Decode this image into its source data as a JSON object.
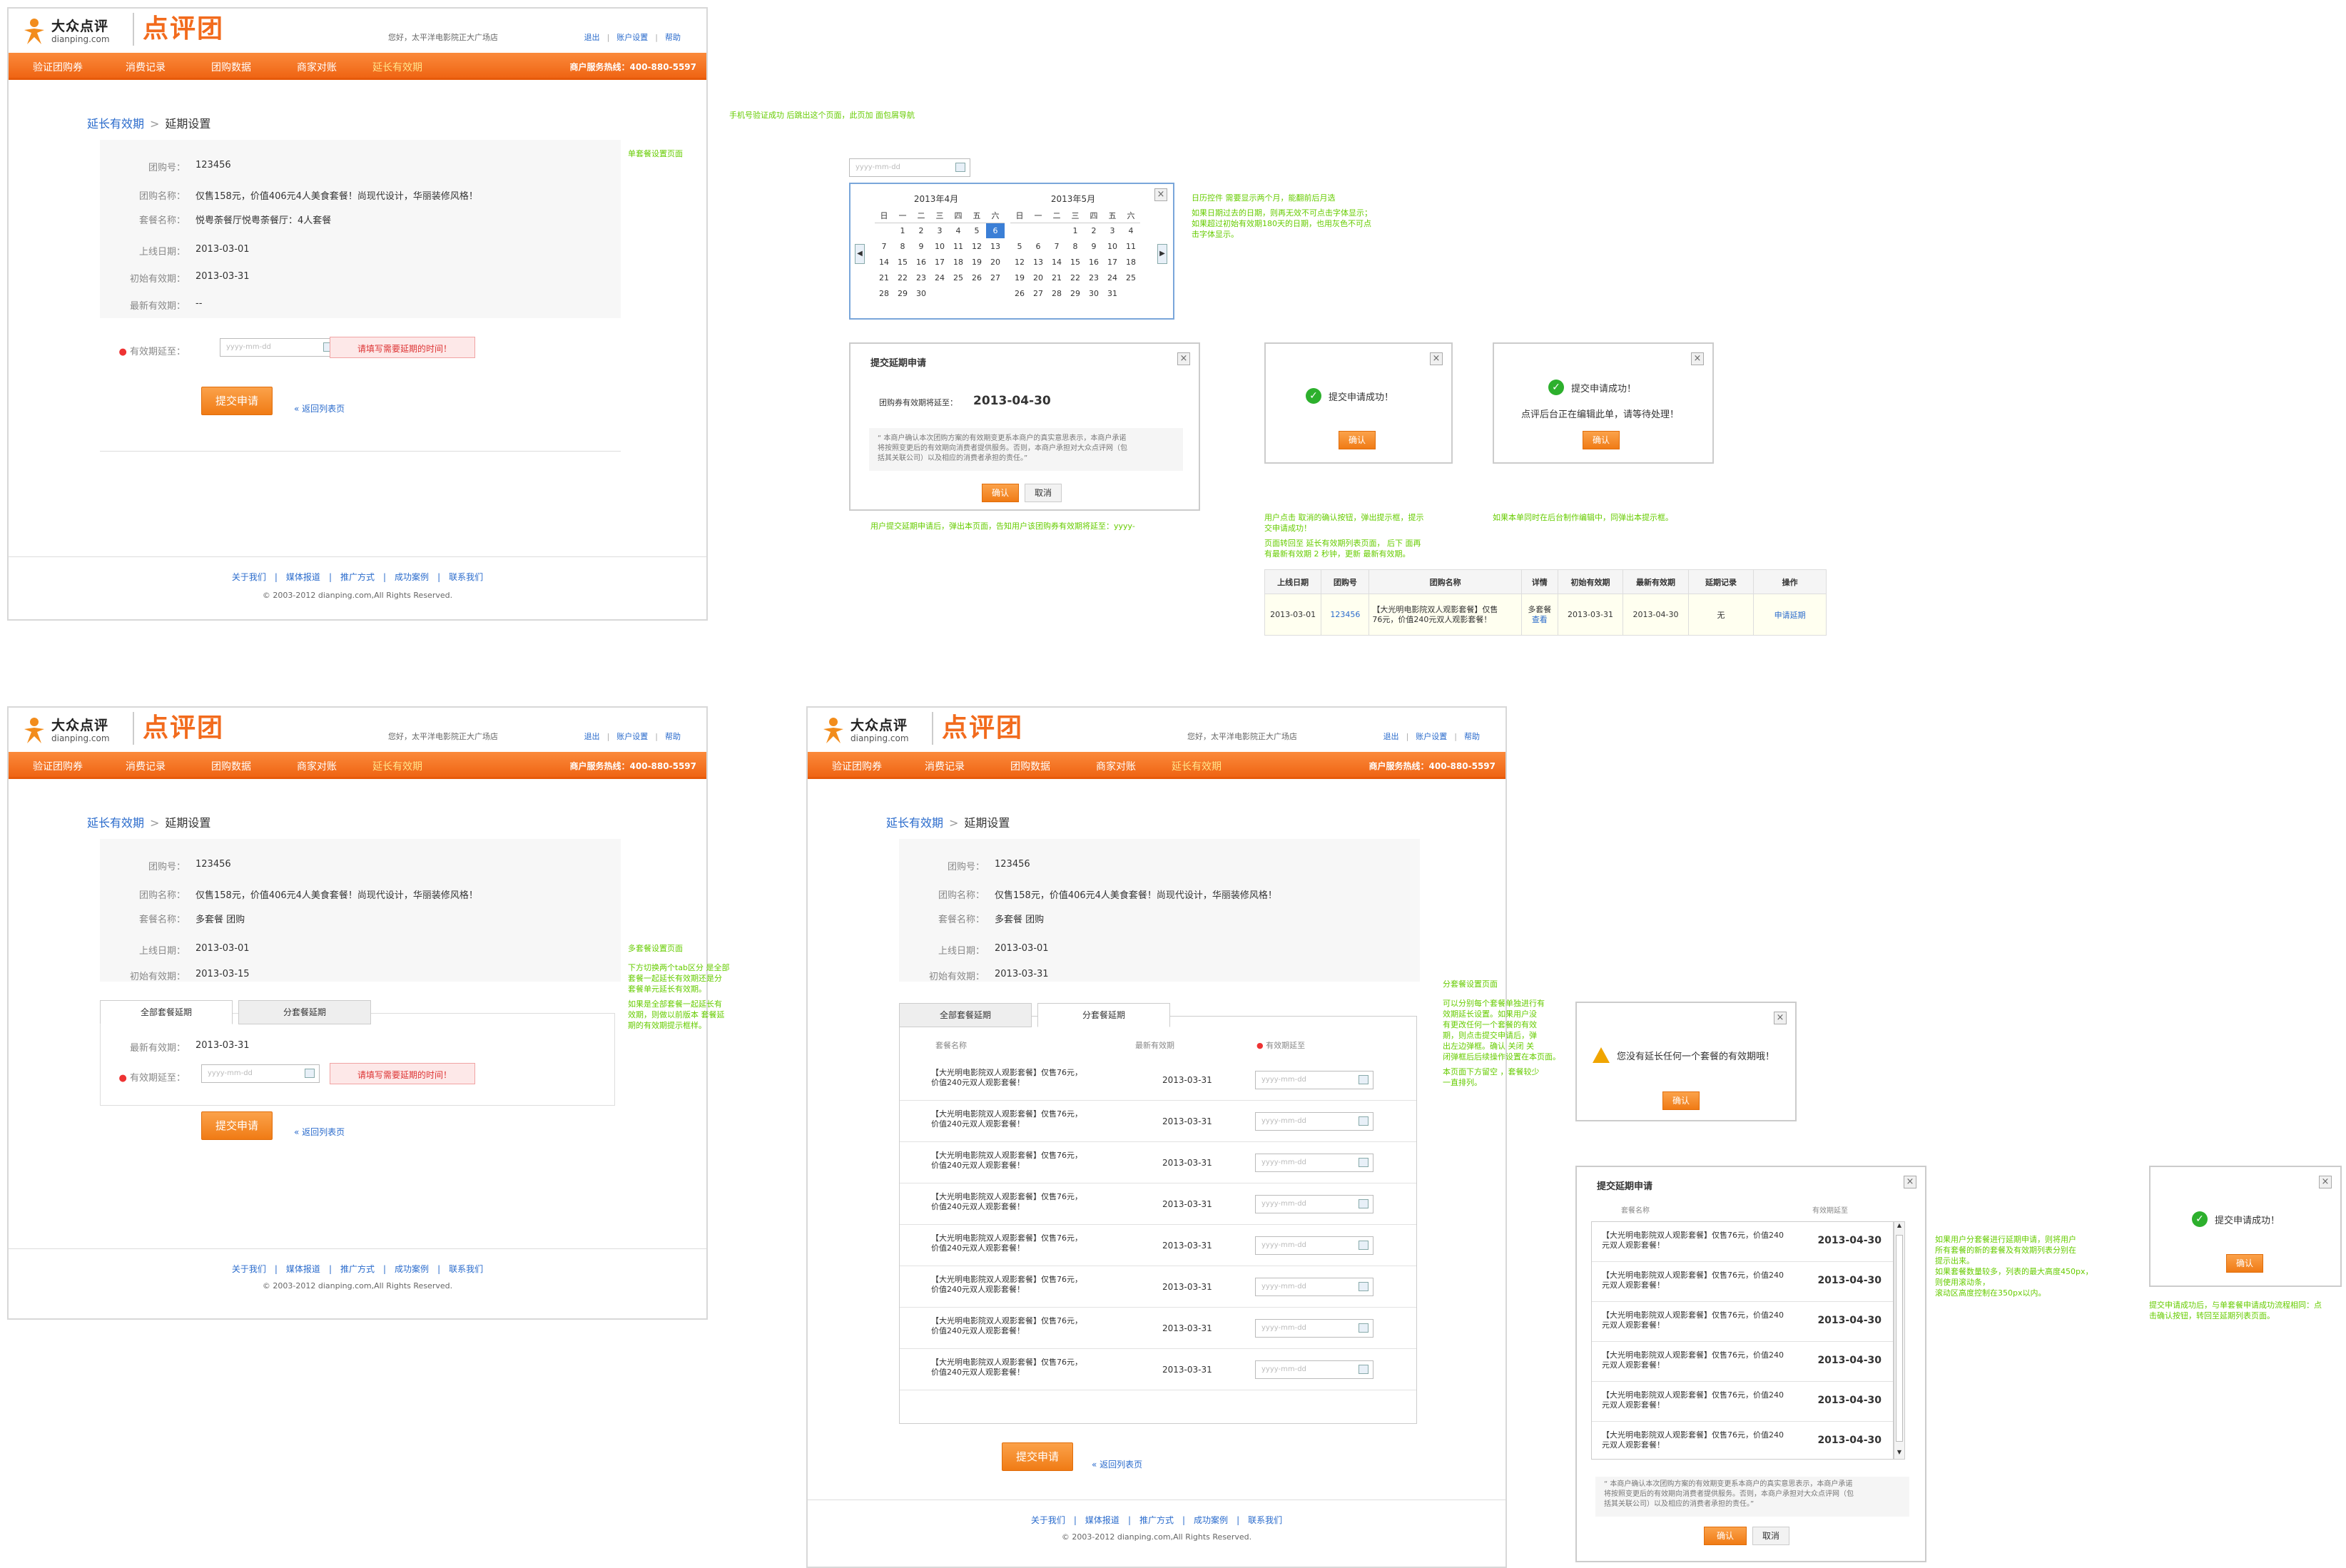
{
  "header": {
    "logo_cn": "大众点评",
    "logo_en": "dianping.com",
    "brand": "点评团",
    "greeting": "您好，太平洋电影院正大广场店",
    "links": [
      "退出",
      "账户设置",
      "帮助"
    ],
    "nav": [
      "验证团购券",
      "消费记录",
      "团购数据",
      "商家对账",
      "延长有效期"
    ],
    "hotline": "商户服务热线：400-880-5597"
  },
  "crumb": {
    "parent": "延长有效期",
    "current": "延期设置"
  },
  "labels": {
    "deal_id": "团购号：",
    "deal_name": "团购名称：",
    "package": "套餐名称：",
    "online": "上线日期：",
    "init_valid": "初始有效期：",
    "latest_valid": "最新有效期：",
    "extend_to": "有效期延至："
  },
  "deal": {
    "id": "123456",
    "name": "仅售158元，价值406元4人美食套餐！尚现代设计，华丽装修风格！",
    "package1": "悦粤荼餐厅悦粤荼餐厅：4人套餐",
    "package2": "多套餐 团购",
    "online": "2013-03-01",
    "init1": "2013-03-31",
    "init2": "2013-03-15",
    "latest1": "--",
    "latest2": "2013-03-31"
  },
  "form": {
    "date_placeholder": "yyyy-mm-dd",
    "error": "请填写需要延期的时间！",
    "submit": "提交申请",
    "back": "« 返回列表页"
  },
  "footer": {
    "links": [
      "关于我们",
      "媒体报道",
      "推广方式",
      "成功案例",
      "联系我们"
    ],
    "copyright": "© 2003-2012 dianping.com,All Rights Reserved."
  },
  "tabs": {
    "all": "全部套餐延期",
    "sub": "分套餐延期"
  },
  "pkg_table": {
    "h_name": "套餐名称",
    "h_latest": "最新有效期",
    "h_extend": "有效期延至",
    "item_line1": "【大光明电影院双人观影套餐】仅售76元，",
    "item_line2": "价值240元双人观影套餐！",
    "date": "2013-03-31"
  },
  "calendar": {
    "m1": "2013年4月",
    "m2": "2013年5月",
    "weekdays": [
      "日",
      "一",
      "二",
      "三",
      "四",
      "五",
      "六"
    ]
  },
  "dialogs": {
    "submit_title": "提交延期申请",
    "valid_to_label": "团购券有效期将延至：",
    "valid_to": "2013-04-30",
    "disclaimer1": "“ 本商户确认本次团购方案的有效期变更系本商户的真实意思表示，本商户承诺",
    "disclaimer2": "将按照变更后的有效期向消费者提供服务。否则，本商户承担对大众点评网（包",
    "disclaimer3": "括其关联公司）以及相应的消费者承担的责任。”",
    "confirm": "确认",
    "cancel": "取消",
    "success": "提交申请成功！",
    "success2": "点评后台正在编辑此单，请等待处理！",
    "warn": "您没有延长任何一个套餐的有效期哦！",
    "col_name": "套餐名称",
    "col_valid": "有效期延至",
    "m_line1": "【大光明电影院双人观影套餐】仅售76元，价值240",
    "m_line2": "元双人观影套餐！",
    "m_date": "2013-04-30"
  },
  "list_table": {
    "headers": [
      "上线日期",
      "团购号",
      "团购名称",
      "详情",
      "初始有效期",
      "最新有效期",
      "延期记录",
      "操作"
    ],
    "row": {
      "online": "2013-03-01",
      "id": "123456",
      "name1": "【大光明电影院双人观影套餐】仅售",
      "name2": "76元，价值240元双人观影套餐！",
      "detail1": "多套餐",
      "detail2": "查看",
      "init": "2013-03-31",
      "latest": "2013-04-30",
      "record": "无",
      "op": "申请延期"
    }
  },
  "notes": {
    "n_sms": "手机号验证成功  后跳出这个页面，此页加  面包屑导航",
    "n_single": "单套餐设置页面",
    "n_cal1": "日历控件 需要显示两个月，能翻前后月选",
    "n_cal2": "如果日期过去的日期，则再无效不可点击字体显示；",
    "n_cal3": "如果超过初始有效期180天的日期，也用灰色不可点",
    "n_cal4": "击字体显示。",
    "n_submit": "用户提交延期申请后，弹出本页面，告知用户该团购券有效期将延至：yyyy-",
    "n_ok1": "用户点击 取消的确认按钮，弹出提示框，提示",
    "n_ok2": "交申请成功！",
    "n_ok3": "页面转回至  延长有效期列表页面，  后下  面再",
    "n_ok4": "有最新有效期  2  秒钟，更新  最新有效期。",
    "n_edit": "如果本单同时在后台制作编辑中，同弹出本提示框。",
    "n_multi": "多套餐设置页面",
    "n_m1": "下方切换两个tab区分  是全部",
    "n_m2": "套餐一起延长有效期还是分",
    "n_m3": "套餐单元延长有效期。",
    "n_m4": "如果是全部套餐一起延长有",
    "n_m5": "效期，则做以前版本  套餐延",
    "n_m6": "期的有效期提示框样。",
    "n_sub": "分套餐设置页面",
    "n_s1": "可以分别每个套餐单独进行有",
    "n_s2": "效期延长设置。如果用户没",
    "n_s3": "有更改任何一个套餐的有效",
    "n_s4": "期，则点击提交申请后，弹",
    "n_s5": "出左边弹框。确认  关闭  关",
    "n_s6": "闭弹框后后续操作设置在本页面。",
    "n_s7": "本页面下方留空  ，套餐较少",
    "n_s8": "一直排列。",
    "n_d1": "如果用户分套餐进行延期申请，则将用户",
    "n_d2": "所有套餐的新的套餐及有效期列表分别在",
    "n_d3": "提示出来。",
    "n_d4": "如果套餐数量较多，列表的最大高度450px，",
    "n_d5": "则使用滚动条，",
    "n_d6": "滚动区高度控制在350px以内。",
    "n_f1": "提交申请成功后，与单套餐申请成功流程相同：点",
    "n_f2": "击确认按钮，转回至延期列表页面。"
  }
}
